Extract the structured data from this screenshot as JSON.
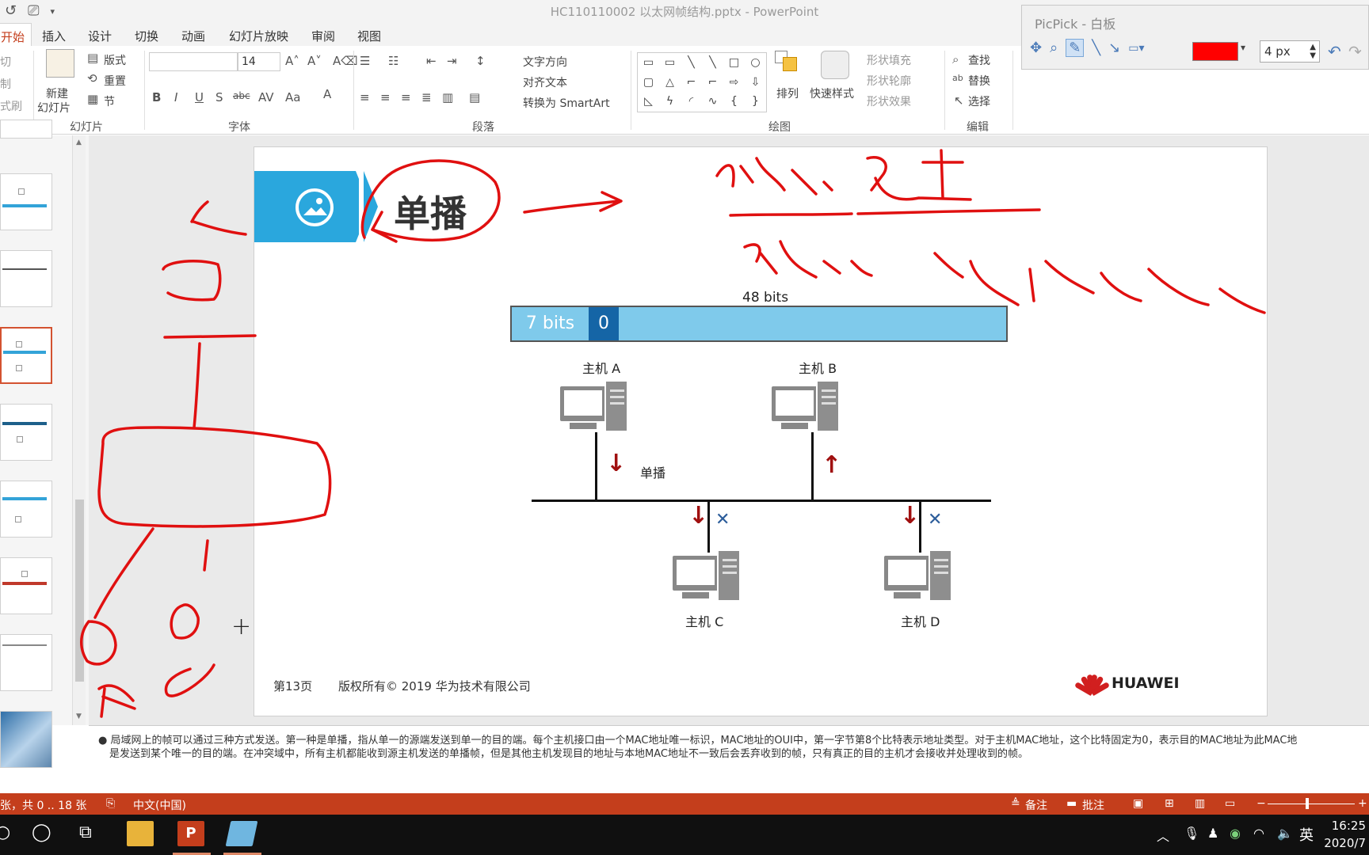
{
  "window": {
    "title": "HC110110002 以太网帧结构.pptx - PowerPoint"
  },
  "ribbon": {
    "tabs": [
      "开始",
      "插入",
      "设计",
      "切换",
      "动画",
      "幻灯片放映",
      "审阅",
      "视图"
    ],
    "active_tab": "开始",
    "clipboard": [
      "切",
      "制",
      "式刷"
    ],
    "slides_group": {
      "new_slide": "新建",
      "new_slide2": "幻灯片",
      "layout": "版式",
      "reset": "重置",
      "section": "节",
      "label": "幻灯片"
    },
    "font_group": {
      "font_size": "14",
      "label": "字体"
    },
    "paragraph_group": {
      "text_direction": "文字方向",
      "align_text": "对齐文本",
      "smartart": "转换为 SmartArt",
      "label": "段落"
    },
    "drawing_group": {
      "arrange": "排列",
      "quick_styles": "快速样式",
      "shape_fill": "形状填充",
      "shape_outline": "形状轮廓",
      "shape_effects": "形状效果",
      "label": "绘图"
    },
    "editing_group": {
      "find": "查找",
      "replace": "替换",
      "select": "选择",
      "label": "编辑"
    }
  },
  "picpick": {
    "title": "PicPick - 白板",
    "pen_color": "#ff0000",
    "pen_size": "4 px"
  },
  "slide": {
    "title": "单播",
    "frame_total": "48 bits",
    "frame_first": "7 bits",
    "frame_bit": "0",
    "hosts": [
      "主机 A",
      "主机 B",
      "主机 C",
      "主机 D"
    ],
    "unicast_label": "单播",
    "page": "第13页",
    "copyright": "版权所有© 2019 华为技术有限公司",
    "logo": "HUAWEI"
  },
  "notes": {
    "line1": "局域网上的帧可以通过三种方式发送。第一种是单播，指从单一的源端发送到单一的目的端。每个主机接口由一个MAC地址唯一标识，MAC地址的OUI中，第一字节第8个比特表示地址类型。对于主机MAC地址，这个比特固定为0，表示目的MAC地址为此MAC地",
    "line2": "是发送到某个唯一的目的端。在冲突域中，所有主机都能收到源主机发送的单播帧，但是其他主机发现目的地址与本地MAC地址不一致后会丢弃收到的帧，只有真正的目的主机才会接收并处理收到的帧。"
  },
  "status": {
    "slide_info": "张，共 0 .. 18 张",
    "language": "中文(中国)",
    "notes_btn": "备注",
    "comments_btn": "批注"
  },
  "taskbar": {
    "ime": "英",
    "time": "16:25",
    "date": "2020/7"
  },
  "colors": {
    "accent": "#c43e1c",
    "banner": "#2aa7dd",
    "ink": "#e01010"
  }
}
